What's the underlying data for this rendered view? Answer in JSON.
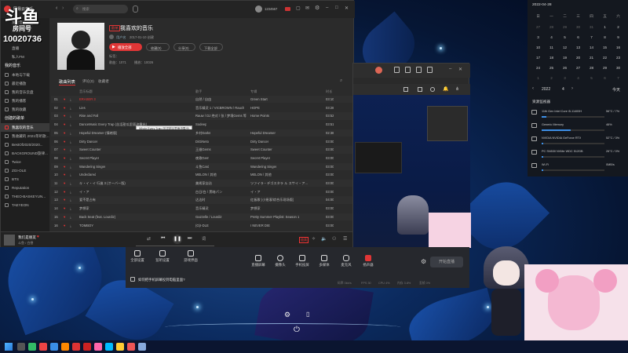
{
  "overlay": {
    "logo_text": "斗鱼",
    "room_label": "房间号",
    "room_number": "10020736"
  },
  "music_app": {
    "app_name": "网易云音乐",
    "search_placeholder": "搜索",
    "user_name": "1234567",
    "playlist": {
      "badge": "歌单",
      "title": "我喜欢的音乐",
      "creator": "用户名",
      "created": "2017-01-10 创建",
      "play_all": "播放全部",
      "collect": "收藏(0)",
      "share": "分享(0)",
      "download": "下载全部",
      "tags_label": "标签：",
      "count_label": "歌曲：1071",
      "plays_label": "播放：10026"
    },
    "tabs": [
      "歌曲列表",
      "评论(0)",
      "收藏者"
    ],
    "columns": [
      "音乐标题",
      "歌手",
      "专辑",
      "时长"
    ],
    "sidebar": {
      "top_items": [
        "发现音乐",
        "视频",
        "朋友",
        "直播",
        "私人FM"
      ],
      "my_header": "我的音乐",
      "my_items": [
        "本地与下载",
        "最近播放",
        "我的音乐云盘",
        "我的播客",
        "我的收藏"
      ],
      "list_header": "创建的歌单",
      "playlists": [
        "我喜欢的音乐",
        "我收藏的 2021年听歌...",
        "BestOf2020/2020...",
        "BACKGROUND旋律...",
        "Twice",
        "ZGI-OLE",
        "BTS",
        "Reputation",
        "THEO-BASKEYUN...",
        "TAEYEON"
      ]
    },
    "tracks": [
      {
        "title": "ERASER 3",
        "artist": "自然 / 自由",
        "album": "Green Start",
        "time": "03:10",
        "playing": true
      },
      {
        "title": "Lies",
        "artist": "音乐精灵 1 / VICBROWN / Rauch",
        "album": "HOPE",
        "time": "03:28"
      },
      {
        "title": "Rise and Fall",
        "artist": "Rauw / DJ 绝对 / 张 / 梦境Gems 等",
        "album": "Home Points",
        "time": "03:52"
      },
      {
        "title": "DanceMusic Every Trap (苦涩甜瓜里面流露出)",
        "artist": "Sodeep",
        "album": "",
        "time": "03:51"
      },
      {
        "title": "Hopeful Dreamer (情绪版)",
        "artist": "乡村Darks",
        "album": "Hopeful Dreamer",
        "time": "02:38"
      },
      {
        "title": "Dirty Dancer",
        "artist": "DiGiNeto",
        "album": "Dirty Dancer",
        "time": "03:00"
      },
      {
        "title": "Sweet Counter",
        "artist": "王维Gems",
        "album": "Sweet Counter",
        "time": "03:00"
      },
      {
        "title": "Secret Player",
        "artist": "夜歌Gem",
        "album": "Secret Player",
        "time": "03:00"
      },
      {
        "title": "Wandering Singer",
        "artist": "斗鱼Card",
        "album": "Wandering Singer",
        "time": "03:00"
      },
      {
        "title": "Undeclared",
        "artist": "MELON / 其他",
        "album": "MELON / 其他",
        "time": "03:00"
      },
      {
        "title": "キ・イ・イ 行進 3 (オーバー版)",
        "artist": "美術家自治",
        "album": "ツァイラ・デゴスタラ ル スサイ・ア...",
        "time": "03:00"
      },
      {
        "title": "イ・ア",
        "artist": "白日/白 / 黑暗パン",
        "album": "イ・ア",
        "time": "03:00"
      },
      {
        "title": "爱不是占有",
        "artist": "达达时",
        "album": "红板歌 (小摇滚/综合乐现场版)",
        "time": "04:00"
      },
      {
        "title": "梦想家",
        "artist": "音乐精灵",
        "album": "梦想家",
        "time": "03:00"
      },
      {
        "title": "Back Seat (feat. Lourdiz)",
        "artist": "Gazzelle / Lourdiz",
        "album": "Pretty Summer Playlist: Season 1",
        "time": "03:00"
      },
      {
        "title": "TOMBOY",
        "artist": "(G)I-DLE",
        "album": "I NEVER DIE",
        "time": "03:00"
      }
    ],
    "tooltip": "Whole Every Trap (苦涩甜瓜里面流露出)",
    "player": {
      "song": "我们是朋友",
      "artist": "斗鱼 / 白昼"
    }
  },
  "widget": {
    "date": "2022-04-28",
    "weekdays": [
      "日",
      "一",
      "二",
      "三",
      "四",
      "五",
      "六"
    ],
    "days": [
      [
        "27",
        "28",
        "29",
        "30",
        "31",
        "1",
        "2"
      ],
      [
        "3",
        "4",
        "5",
        "6",
        "7",
        "8",
        "9"
      ],
      [
        "10",
        "11",
        "12",
        "13",
        "14",
        "15",
        "16"
      ],
      [
        "17",
        "18",
        "19",
        "20",
        "21",
        "22",
        "23"
      ],
      [
        "24",
        "25",
        "26",
        "27",
        "28",
        "29",
        "30"
      ],
      [
        "1",
        "2",
        "3",
        "4",
        "5",
        "6",
        "7"
      ]
    ],
    "year": "2022",
    "month": "4",
    "today_label": "今天",
    "hw_title": "资源监视器",
    "hardware": [
      {
        "name": "11th Gen Intel Core i5-11400H",
        "value": "56°C / 7%",
        "level": 0.07
      },
      {
        "name": "Generic Memory",
        "value": "46%",
        "level": 0.46
      },
      {
        "name": "NVIDIA NVIDIA GeForce RTX",
        "value": "52°C / 3%",
        "level": 0.03
      },
      {
        "name": "PC SN530 NVMe WDC 512GB",
        "value": "26°C / 0%",
        "level": 0.0
      },
      {
        "name": "Wi-Fi",
        "value": "0MB/s",
        "level": 0.0
      }
    ]
  },
  "stream_tools": {
    "tools": [
      "直播屏幕",
      "摄像头",
      "手机投屏",
      "多媒体",
      "麦克风",
      "扬声器"
    ],
    "tools2": [
      "全部设置",
      "监听设置",
      "游戏界面"
    ],
    "hint": "如何把手机屏幕投到电脑里面?",
    "go_live": "开始直播",
    "stats": [
      "码率 0kb/s",
      "FPS 30",
      "CPU 4%",
      "内存 3.8%",
      "丢帧 0%"
    ]
  },
  "colors": {
    "accent_red": "#e03636",
    "bg_dark": "#2b2b2b",
    "sidebar": "#1f1f1f"
  }
}
